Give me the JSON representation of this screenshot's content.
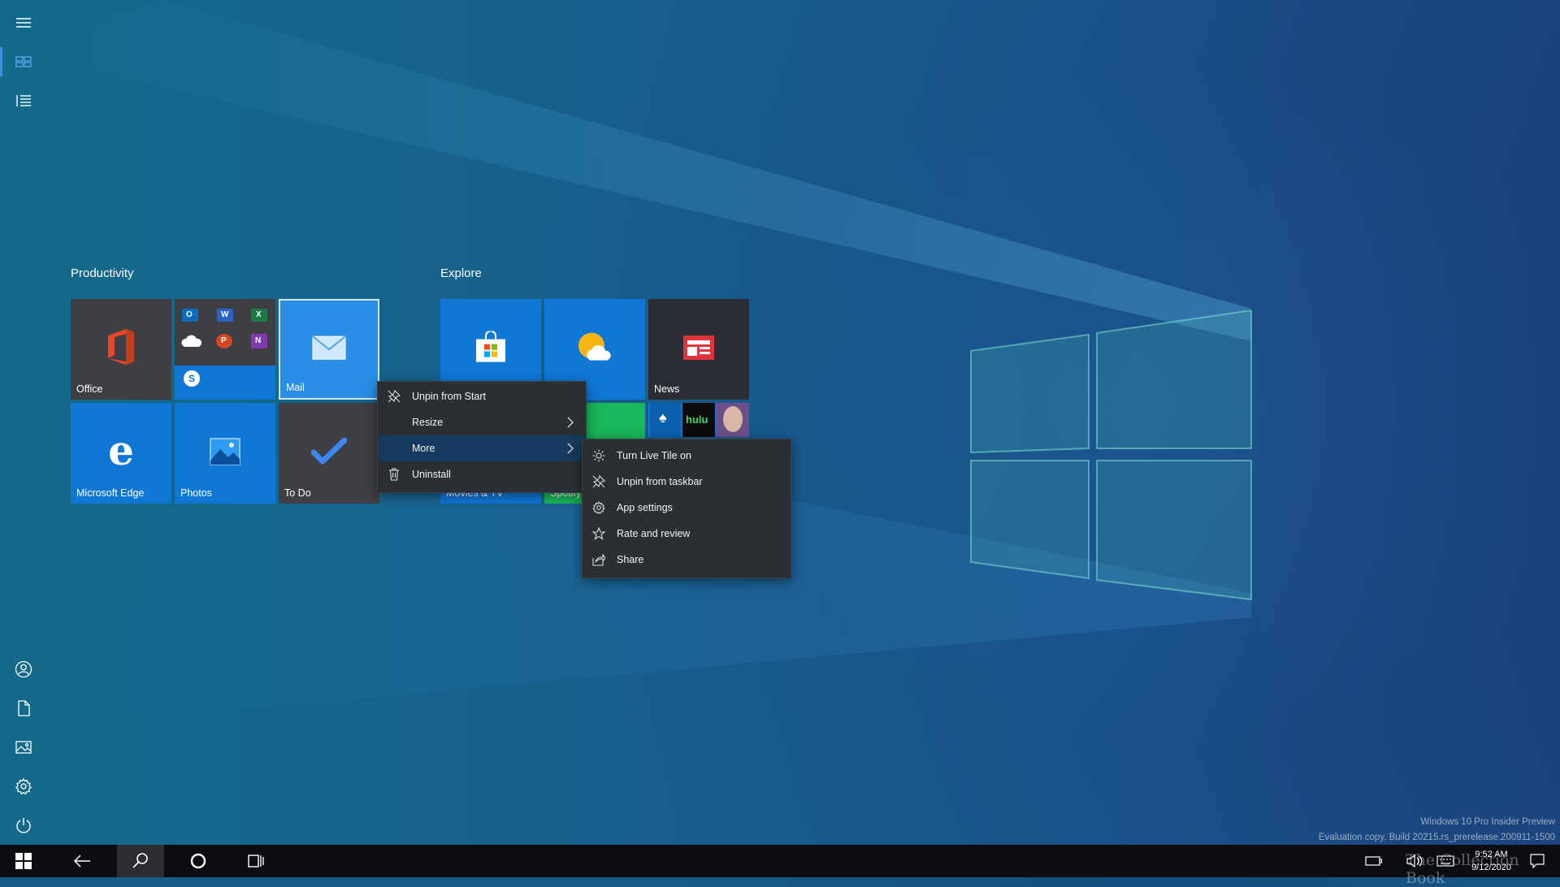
{
  "start_rail": {
    "menu_label": "Expand",
    "items": [
      "hamburger-icon",
      "tiles-icon",
      "all-apps-icon",
      "user-icon",
      "documents-icon",
      "pictures-icon",
      "settings-icon",
      "power-icon"
    ]
  },
  "groups": [
    {
      "title": "Productivity"
    },
    {
      "title": "Explore"
    }
  ],
  "tiles": {
    "office": "Office",
    "mail": "Mail",
    "edge": "Microsoft Edge",
    "photos": "Photos",
    "todo": "To Do",
    "news": "News",
    "hulu": "hulu",
    "movies_partial": "Movies & TV",
    "spotify_partial": "Spotify"
  },
  "context_menu": {
    "items": [
      {
        "label": "Unpin from Start",
        "icon": "unpin-icon"
      },
      {
        "label": "Resize",
        "icon": "",
        "submenu": true
      },
      {
        "label": "More",
        "icon": "",
        "submenu": true,
        "highlighted": true
      },
      {
        "label": "Uninstall",
        "icon": "trash-icon"
      }
    ]
  },
  "submenu": {
    "items": [
      {
        "label": "Turn Live Tile on",
        "icon": "live-tile-icon"
      },
      {
        "label": "Unpin from taskbar",
        "icon": "unpin-icon"
      },
      {
        "label": "App settings",
        "icon": "gear-icon"
      },
      {
        "label": "Rate and review",
        "icon": "star-icon"
      },
      {
        "label": "Share",
        "icon": "share-icon"
      }
    ]
  },
  "taskbar": {
    "time": "9:52 AM",
    "date": "9/12/2020"
  },
  "watermark": {
    "line1": "Windows 10 Pro Insider Preview",
    "line2": "Evaluation copy. Build 20215.rs_prerelease.200911-1500",
    "overlay": "The Collection Book"
  },
  "colors": {
    "tile_blue": "#0f78d7",
    "tile_dark": "#3d3f44",
    "menu_bg": "#2b2f34",
    "menu_highlight": "#163a5f",
    "taskbar": "#0c0d10"
  }
}
